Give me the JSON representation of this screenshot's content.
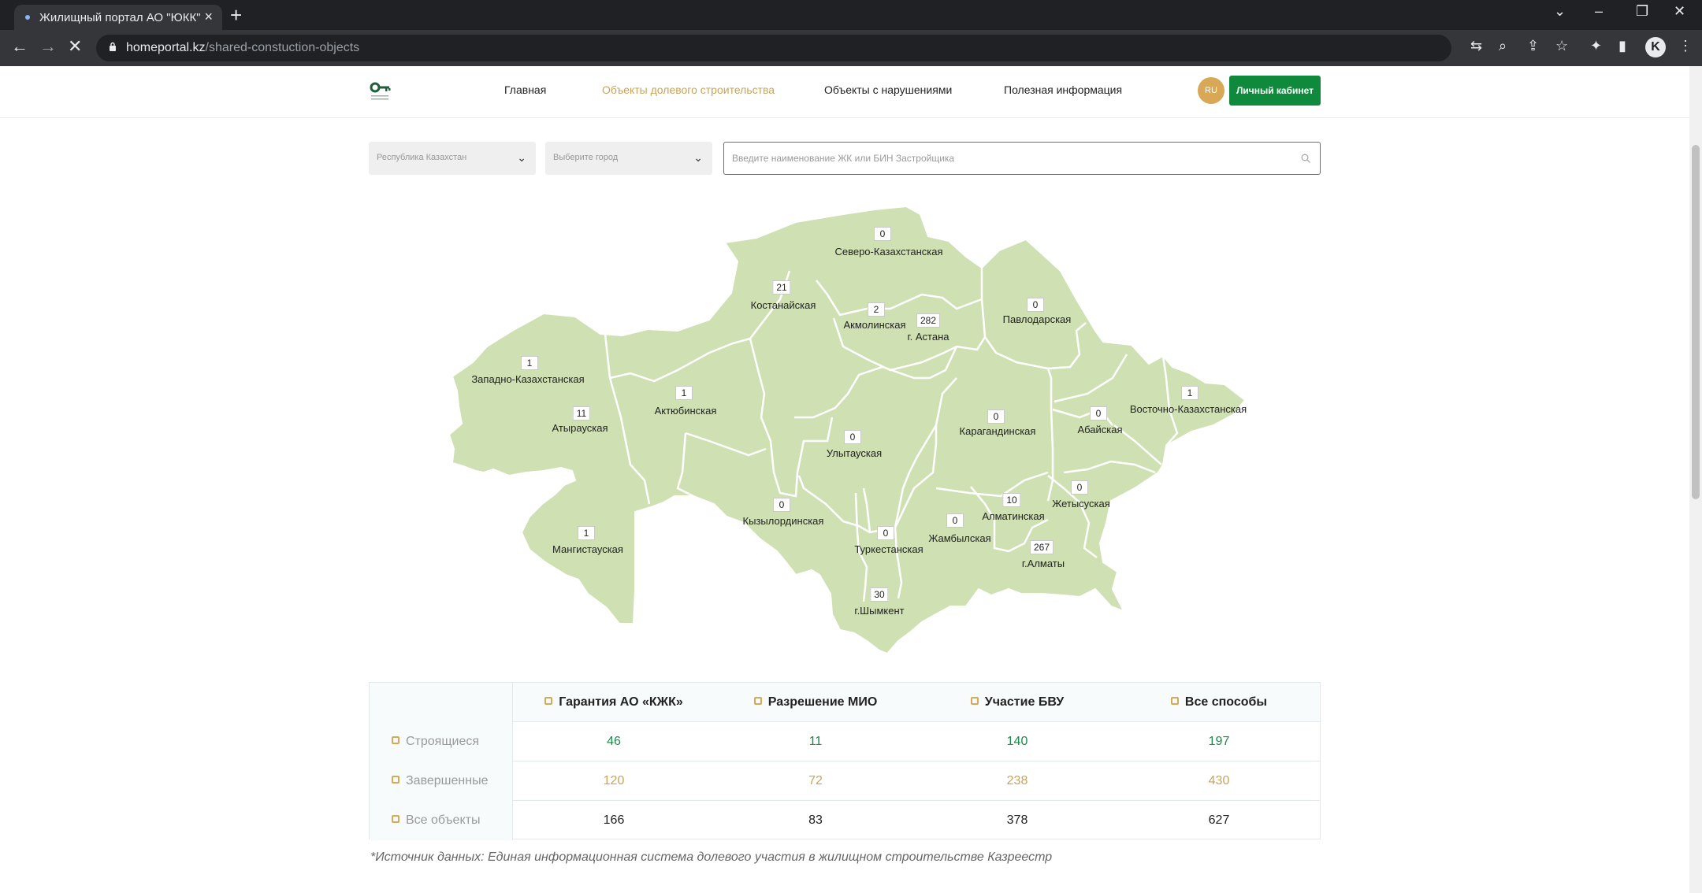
{
  "browser": {
    "tab_title": "Жилищный портал АО \"ЮКК\"",
    "url_host": "homeportal.kz",
    "url_path": "/shared-constuction-objects",
    "profile_letter": "K"
  },
  "header": {
    "nav": [
      {
        "label": "Главная",
        "active": false
      },
      {
        "label": "Объекты долевого строительства",
        "active": true
      },
      {
        "label": "Объекты с нарушениями",
        "active": false
      },
      {
        "label": "Полезная информация",
        "active": false
      }
    ],
    "lang": "RU",
    "cabinet_label": "Личный кабинет"
  },
  "filters": {
    "region_select": "Республика Казахстан",
    "city_select": "Выберите город",
    "search_placeholder": "Введите наименование ЖК или БИН Застройщика"
  },
  "map": {
    "fill_color": "#cfe0b3",
    "regions": [
      {
        "name": "Северо-Казахстанская",
        "count": "0"
      },
      {
        "name": "Костанайская",
        "count": "21"
      },
      {
        "name": "Акмолинская",
        "count": "2"
      },
      {
        "name": "г. Астана",
        "count": "282"
      },
      {
        "name": "Павлодарская",
        "count": "0"
      },
      {
        "name": "Западно-Казахстанская",
        "count": "1"
      },
      {
        "name": "Актюбинская",
        "count": "1"
      },
      {
        "name": "Атырауская",
        "count": "11"
      },
      {
        "name": "Улытауская",
        "count": "0"
      },
      {
        "name": "Карагандинская",
        "count": "0"
      },
      {
        "name": "Абайская",
        "count": "0"
      },
      {
        "name": "Восточно-Казахстанская",
        "count": "1"
      },
      {
        "name": "Мангистауская",
        "count": "1"
      },
      {
        "name": "Кызылординская",
        "count": "0"
      },
      {
        "name": "Туркестанская",
        "count": "0"
      },
      {
        "name": "Жамбылская",
        "count": "0"
      },
      {
        "name": "Алматинская",
        "count": "10"
      },
      {
        "name": "Жетысуская",
        "count": "0"
      },
      {
        "name": "г.Алматы",
        "count": "267"
      },
      {
        "name": "г.Шымкент",
        "count": "30"
      }
    ]
  },
  "table": {
    "columns": [
      "Гарантия АО «КЖК»",
      "Разрешение МИО",
      "Участие БВУ",
      "Все способы"
    ],
    "rows": [
      {
        "label": "Строящиеся",
        "values": [
          "46",
          "11",
          "140",
          "197"
        ]
      },
      {
        "label": "Завершенные",
        "values": [
          "120",
          "72",
          "238",
          "430"
        ]
      },
      {
        "label": "Все объекты",
        "values": [
          "166",
          "83",
          "378",
          "627"
        ]
      }
    ]
  },
  "source_note": "*Источник данных: Единая информационная система долевого участия в жилищном строительстве Казреестр"
}
